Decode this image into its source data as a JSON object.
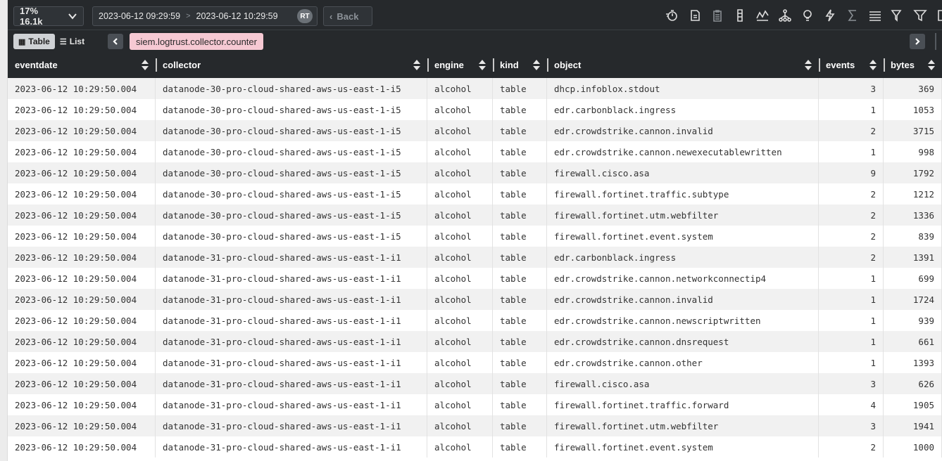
{
  "toolbar": {
    "sampling_label": "17% 16.1k",
    "range_from": "2023-06-12 09:29:59",
    "range_sep": ">",
    "range_to": "2023-06-12 10:29:59",
    "realtime_badge": "RT",
    "back_label": "Back",
    "action_icons": [
      "timer-icon",
      "document-sync-icon",
      "clipboard-icon",
      "columns-icon",
      "timeline-icon",
      "hierarchy-icon",
      "lightbulb-icon",
      "lightning-icon",
      "aggregate-icon",
      "stack-icon",
      "filter-or-icon",
      "filter-icon",
      "panel-icon"
    ]
  },
  "subbar": {
    "table_label": "Table",
    "list_label": "List",
    "active_tab": "siem.logtrust.collector.counter"
  },
  "columns": [
    {
      "label": "eventdate"
    },
    {
      "label": "collector"
    },
    {
      "label": "engine"
    },
    {
      "label": "kind"
    },
    {
      "label": "object"
    },
    {
      "label": "events"
    },
    {
      "label": "bytes"
    }
  ],
  "rows": [
    [
      "2023-06-12 10:29:50.004",
      "datanode-30-pro-cloud-shared-aws-us-east-1-i5",
      "alcohol",
      "table",
      "dhcp.infoblox.stdout",
      "3",
      "369"
    ],
    [
      "2023-06-12 10:29:50.004",
      "datanode-30-pro-cloud-shared-aws-us-east-1-i5",
      "alcohol",
      "table",
      "edr.carbonblack.ingress",
      "1",
      "1053"
    ],
    [
      "2023-06-12 10:29:50.004",
      "datanode-30-pro-cloud-shared-aws-us-east-1-i5",
      "alcohol",
      "table",
      "edr.crowdstrike.cannon.invalid",
      "2",
      "3715"
    ],
    [
      "2023-06-12 10:29:50.004",
      "datanode-30-pro-cloud-shared-aws-us-east-1-i5",
      "alcohol",
      "table",
      "edr.crowdstrike.cannon.newexecutablewritten",
      "1",
      "998"
    ],
    [
      "2023-06-12 10:29:50.004",
      "datanode-30-pro-cloud-shared-aws-us-east-1-i5",
      "alcohol",
      "table",
      "firewall.cisco.asa",
      "9",
      "1792"
    ],
    [
      "2023-06-12 10:29:50.004",
      "datanode-30-pro-cloud-shared-aws-us-east-1-i5",
      "alcohol",
      "table",
      "firewall.fortinet.traffic.subtype",
      "2",
      "1212"
    ],
    [
      "2023-06-12 10:29:50.004",
      "datanode-30-pro-cloud-shared-aws-us-east-1-i5",
      "alcohol",
      "table",
      "firewall.fortinet.utm.webfilter",
      "2",
      "1336"
    ],
    [
      "2023-06-12 10:29:50.004",
      "datanode-30-pro-cloud-shared-aws-us-east-1-i5",
      "alcohol",
      "table",
      "firewall.fortinet.event.system",
      "2",
      "839"
    ],
    [
      "2023-06-12 10:29:50.004",
      "datanode-31-pro-cloud-shared-aws-us-east-1-i1",
      "alcohol",
      "table",
      "edr.carbonblack.ingress",
      "2",
      "1391"
    ],
    [
      "2023-06-12 10:29:50.004",
      "datanode-31-pro-cloud-shared-aws-us-east-1-i1",
      "alcohol",
      "table",
      "edr.crowdstrike.cannon.networkconnectip4",
      "1",
      "699"
    ],
    [
      "2023-06-12 10:29:50.004",
      "datanode-31-pro-cloud-shared-aws-us-east-1-i1",
      "alcohol",
      "table",
      "edr.crowdstrike.cannon.invalid",
      "1",
      "1724"
    ],
    [
      "2023-06-12 10:29:50.004",
      "datanode-31-pro-cloud-shared-aws-us-east-1-i1",
      "alcohol",
      "table",
      "edr.crowdstrike.cannon.newscriptwritten",
      "1",
      "939"
    ],
    [
      "2023-06-12 10:29:50.004",
      "datanode-31-pro-cloud-shared-aws-us-east-1-i1",
      "alcohol",
      "table",
      "edr.crowdstrike.cannon.dnsrequest",
      "1",
      "661"
    ],
    [
      "2023-06-12 10:29:50.004",
      "datanode-31-pro-cloud-shared-aws-us-east-1-i1",
      "alcohol",
      "table",
      "edr.crowdstrike.cannon.other",
      "1",
      "1393"
    ],
    [
      "2023-06-12 10:29:50.004",
      "datanode-31-pro-cloud-shared-aws-us-east-1-i1",
      "alcohol",
      "table",
      "firewall.cisco.asa",
      "3",
      "626"
    ],
    [
      "2023-06-12 10:29:50.004",
      "datanode-31-pro-cloud-shared-aws-us-east-1-i1",
      "alcohol",
      "table",
      "firewall.fortinet.traffic.forward",
      "4",
      "1905"
    ],
    [
      "2023-06-12 10:29:50.004",
      "datanode-31-pro-cloud-shared-aws-us-east-1-i1",
      "alcohol",
      "table",
      "firewall.fortinet.utm.webfilter",
      "3",
      "1941"
    ],
    [
      "2023-06-12 10:29:50.004",
      "datanode-31-pro-cloud-shared-aws-us-east-1-i1",
      "alcohol",
      "table",
      "firewall.fortinet.event.system",
      "2",
      "1000"
    ]
  ],
  "colors": {
    "toolbar_bg": "#26292c",
    "tab_tag_bg": "#f6c9d3",
    "row_alt_bg": "#f1f1f1"
  }
}
